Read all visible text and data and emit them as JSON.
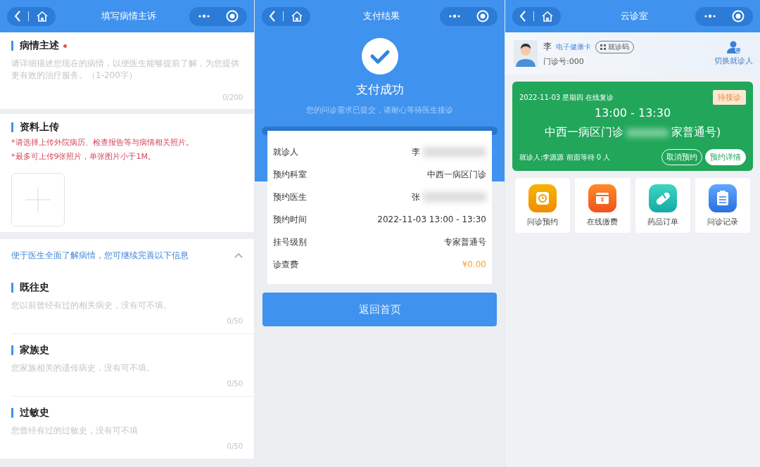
{
  "complaint_screen": {
    "title": "填写病情主诉",
    "sections": [
      {
        "kind": "text",
        "heading": "病情主述",
        "required": true,
        "placeholder": "请详细描述您现在的病情，以便医生能够提前了解，为您提供更有效的治疗服务。（1-200字）",
        "counter": "0/200"
      },
      {
        "kind": "upload",
        "heading": "资料上传",
        "notes": [
          "*请选择上传外院病历、检查报告等与病情相关照片。",
          "*最多可上传9张照片，单张图片小于1M。"
        ]
      }
    ],
    "more_info": {
      "text": "便于医生全面了解病情，您可继续完善以下信息",
      "expanded": true
    },
    "history_fields": [
      {
        "heading": "既往史",
        "placeholder": "您以前曾经有过的相关病史，没有可不填。",
        "counter": "0/50"
      },
      {
        "heading": "家族史",
        "placeholder": "您家族相关的遗传病史，没有可不填。",
        "counter": "0/50"
      },
      {
        "heading": "过敏史",
        "placeholder": "您曾经有过的过敏史，没有可不填",
        "counter": "0/50"
      }
    ]
  },
  "payment_screen": {
    "title": "支付结果",
    "status": "支付成功",
    "message": "您的问诊需求已提交，请耐心等待医生接诊",
    "rows": [
      {
        "label": "就诊人",
        "value": "李",
        "kind": "plain",
        "blurred": true
      },
      {
        "label": "预约科室",
        "value": "中西一病区门诊",
        "kind": "plain",
        "blurred": false
      },
      {
        "label": "预约医生",
        "value": "张",
        "kind": "plain",
        "blurred": true
      },
      {
        "label": "预约时间",
        "value": "2022-11-03 13:00 - 13:30",
        "kind": "plain",
        "blurred": false
      },
      {
        "label": "挂号级别",
        "value": "专家普通号",
        "kind": "plain",
        "blurred": false
      },
      {
        "label": "诊查费",
        "value": "¥0.00",
        "kind": "price",
        "blurred": false
      }
    ],
    "button": "返回首页"
  },
  "clinic_screen": {
    "title": "云诊室",
    "patient": {
      "name": "李",
      "health_card": "电子健康卡",
      "code_button": "就诊码",
      "outpatient_no": "门诊号:000"
    },
    "switch_label": "切换就诊人",
    "appointment": {
      "date_line": "2022-11-03 星期四 在线复诊",
      "status": "待接诊",
      "time": "13:00 - 13:30",
      "department": "中西一病区门诊",
      "level_fragment": "家普通号)",
      "info": "就诊人:李源源 前面等待 0 人",
      "actions": [
        "取消预约",
        "预约详情"
      ]
    },
    "shortcuts": [
      {
        "label": "问诊预约",
        "kind": "clock"
      },
      {
        "label": "在线缴费",
        "kind": "wallet"
      },
      {
        "label": "药品订单",
        "kind": "pill"
      },
      {
        "label": "问诊记录",
        "kind": "clipboard"
      }
    ]
  }
}
